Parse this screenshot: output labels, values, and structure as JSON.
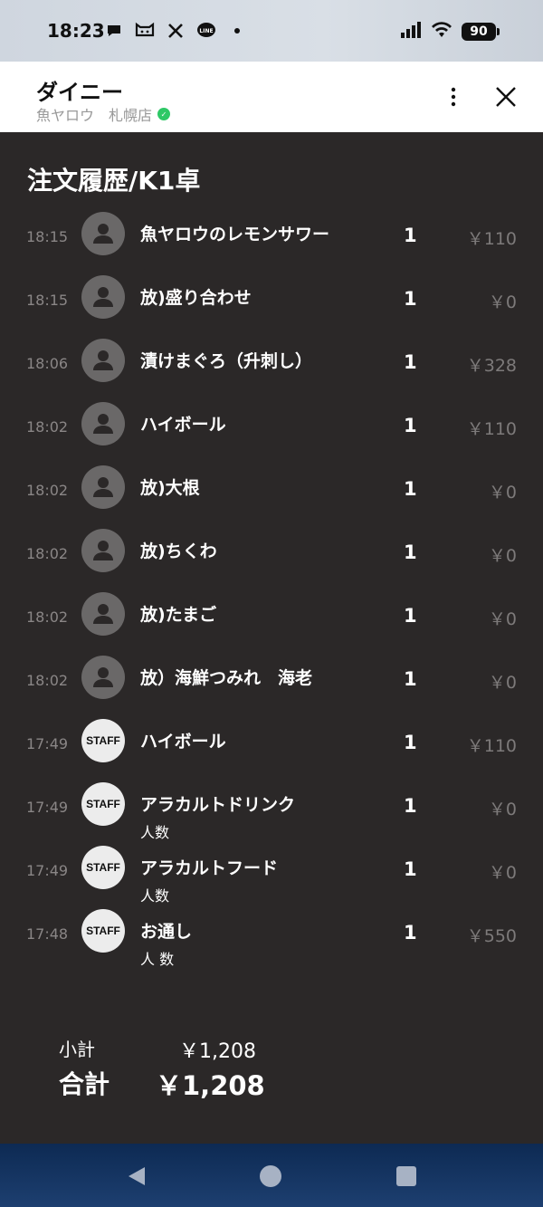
{
  "statusbar": {
    "time": "18:23",
    "app_icons": [
      "chat-bubble-icon",
      "cat-icon",
      "x-icon",
      "line-icon",
      "dot-icon"
    ],
    "battery": "90"
  },
  "header": {
    "title": "ダイニー",
    "subtitle": "魚ヤロウ　札幌店",
    "badge_color": "#2ec866"
  },
  "page": {
    "title": "注文履歴/K1卓"
  },
  "orders": [
    {
      "time": "18:15",
      "avatar": "person",
      "name": "魚ヤロウのレモンサワー",
      "sub": "",
      "qty": "1",
      "price": "￥110"
    },
    {
      "time": "18:15",
      "avatar": "person",
      "name": "放)盛り合わせ",
      "sub": "",
      "qty": "1",
      "price": "￥0"
    },
    {
      "time": "18:06",
      "avatar": "person",
      "name": "漬けまぐろ（升刺し）",
      "sub": "",
      "qty": "1",
      "price": "￥328"
    },
    {
      "time": "18:02",
      "avatar": "person",
      "name": "ハイボール",
      "sub": "",
      "qty": "1",
      "price": "￥110"
    },
    {
      "time": "18:02",
      "avatar": "person",
      "name": "放)大根",
      "sub": "",
      "qty": "1",
      "price": "￥0"
    },
    {
      "time": "18:02",
      "avatar": "person",
      "name": "放)ちくわ",
      "sub": "",
      "qty": "1",
      "price": "￥0"
    },
    {
      "time": "18:02",
      "avatar": "person",
      "name": "放)たまご",
      "sub": "",
      "qty": "1",
      "price": "￥0"
    },
    {
      "time": "18:02",
      "avatar": "person",
      "name": "放）海鮮つみれ　海老",
      "sub": "",
      "qty": "1",
      "price": "￥0"
    },
    {
      "time": "17:49",
      "avatar": "staff",
      "name": "ハイボール",
      "sub": "",
      "qty": "1",
      "price": "￥110"
    },
    {
      "time": "17:49",
      "avatar": "staff",
      "name": "アラカルトドリンク",
      "sub": "人数",
      "qty": "1",
      "price": "￥0"
    },
    {
      "time": "17:49",
      "avatar": "staff",
      "name": "アラカルトフード",
      "sub": "人数",
      "qty": "1",
      "price": "￥0"
    },
    {
      "time": "17:48",
      "avatar": "staff",
      "name": "お通し",
      "sub": "人 数",
      "qty": "1",
      "price": "￥550"
    }
  ],
  "staff_label": "STAFF",
  "totals": {
    "subtotal_label": "小計",
    "subtotal_value": "￥1,208",
    "total_label": "合計",
    "total_value": "￥1,208"
  },
  "colors": {
    "background": "#2b2828",
    "price_gray": "#7d7a7a",
    "time_gray": "#8a8686"
  }
}
